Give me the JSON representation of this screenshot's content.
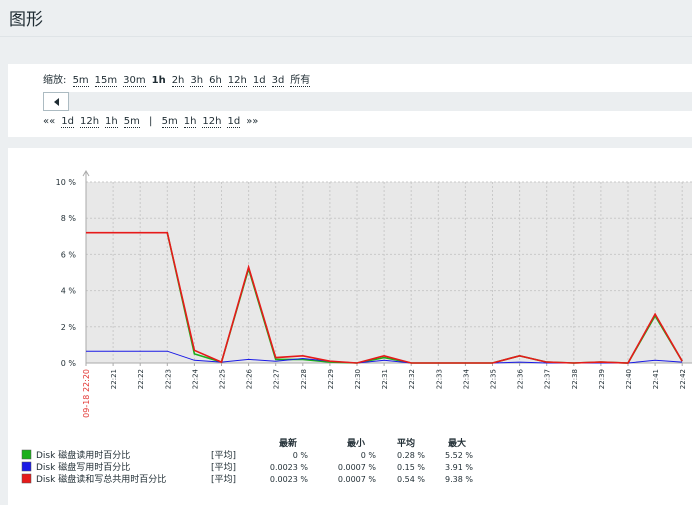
{
  "page": {
    "title": "图形"
  },
  "filter": {
    "zoom_label": "缩放:",
    "zoom_options": [
      "5m",
      "15m",
      "30m",
      "1h",
      "2h",
      "3h",
      "6h",
      "12h",
      "1d",
      "3d",
      "所有"
    ],
    "zoom_active": "1h",
    "back_items": [
      "««",
      "1d",
      "12h",
      "1h",
      "5m"
    ],
    "fwd_items": [
      "5m",
      "1h",
      "12h",
      "1d",
      "»»"
    ],
    "separator": "|"
  },
  "chart_data": {
    "type": "line",
    "y_unit": "%",
    "ylim": [
      0,
      10
    ],
    "y_ticks": [
      "10 %",
      "8 %",
      "6 %",
      "4 %",
      "2 %",
      "0 %"
    ],
    "x_start_label": "09-18 22:20",
    "x": [
      "22:20",
      "22:21",
      "22:22",
      "22:23",
      "22:24",
      "22:25",
      "22:26",
      "22:27",
      "22:28",
      "22:29",
      "22:30",
      "22:31",
      "22:32",
      "22:33",
      "22:34",
      "22:35",
      "22:36",
      "22:37",
      "22:38",
      "22:39",
      "22:40",
      "22:41",
      "22:42"
    ],
    "x_tick_labels": [
      "22:21",
      "22:22",
      "22:23",
      "22:24",
      "22:25",
      "22:26",
      "22:27",
      "22:28",
      "22:29",
      "22:30",
      "22:31",
      "22:32",
      "22:33",
      "22:34",
      "22:35",
      "22:36",
      "22:37",
      "22:38",
      "22:39",
      "22:40",
      "22:41",
      "22:42"
    ],
    "grid": true,
    "series": [
      {
        "name": "Disk 磁盘读用时百分比",
        "color": "#1aaf1a",
        "values": [
          null,
          null,
          null,
          7.2,
          0.5,
          0.05,
          5.2,
          0.2,
          0.2,
          0.05,
          0.0,
          0.3,
          0.0,
          0.0,
          0.0,
          0.0,
          0.4,
          0.05,
          0.0,
          0.05,
          0.0,
          2.6,
          0.1
        ]
      },
      {
        "name": "Disk 磁盘写用时百分比",
        "color": "#1a1ae6",
        "values": [
          0.65,
          0.65,
          0.65,
          0.65,
          0.15,
          0.05,
          0.2,
          0.1,
          0.25,
          0.1,
          0.0,
          0.15,
          0.0,
          0.0,
          0.0,
          0.0,
          0.05,
          0.0,
          0.0,
          0.0,
          0.0,
          0.15,
          0.05
        ]
      },
      {
        "name": "Disk 磁盘读和写总共用时百分比",
        "color": "#e61a1a",
        "values": [
          7.2,
          7.2,
          7.2,
          7.2,
          0.7,
          0.05,
          5.3,
          0.3,
          0.4,
          0.1,
          0.0,
          0.4,
          0.0,
          0.0,
          0.0,
          0.0,
          0.4,
          0.05,
          0.0,
          0.05,
          0.0,
          2.7,
          0.1
        ]
      }
    ],
    "legend": {
      "headers": [
        "最新",
        "最小",
        "平均",
        "最大"
      ],
      "rows": [
        {
          "name": "Disk 磁盘读用时百分比",
          "func": "[平均]",
          "last": "0 %",
          "min": "0 %",
          "avg": "0.28 %",
          "max": "5.52 %"
        },
        {
          "name": "Disk 磁盘写用时百分比",
          "func": "[平均]",
          "last": "0.0023 %",
          "min": "0.0007 %",
          "avg": "0.15 %",
          "max": "3.91 %"
        },
        {
          "name": "Disk 磁盘读和写总共用时百分比",
          "func": "[平均]",
          "last": "0.0023 %",
          "min": "0.0007 %",
          "avg": "0.54 %",
          "max": "9.38 %"
        }
      ]
    }
  }
}
